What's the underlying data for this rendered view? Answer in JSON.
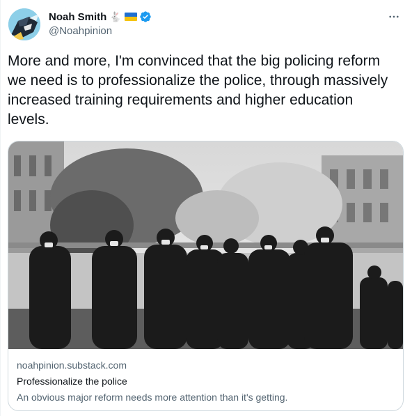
{
  "author": {
    "display_name": "Noah Smith",
    "handle": "@Noahpinion",
    "badges": [
      "rabbit-emoji",
      "ukraine-flag",
      "verified-badge"
    ],
    "verified_color": "#1d9bf0"
  },
  "tweet": {
    "text": "More and more, I'm convinced that the big policing reform we need is to professionalize the police, through massively increased training requirements and higher education levels."
  },
  "card": {
    "image_description_icon": "police-line-photo",
    "domain": "noahpinion.substack.com",
    "title": "Professionalize the police",
    "description": "An obvious major reform needs more attention than it's getting."
  },
  "icons": {
    "more": "more-horizontal-icon",
    "rabbit": "🐇"
  },
  "colors": {
    "text_primary": "#0f1419",
    "text_secondary": "#536471",
    "border": "#cfd9de"
  }
}
